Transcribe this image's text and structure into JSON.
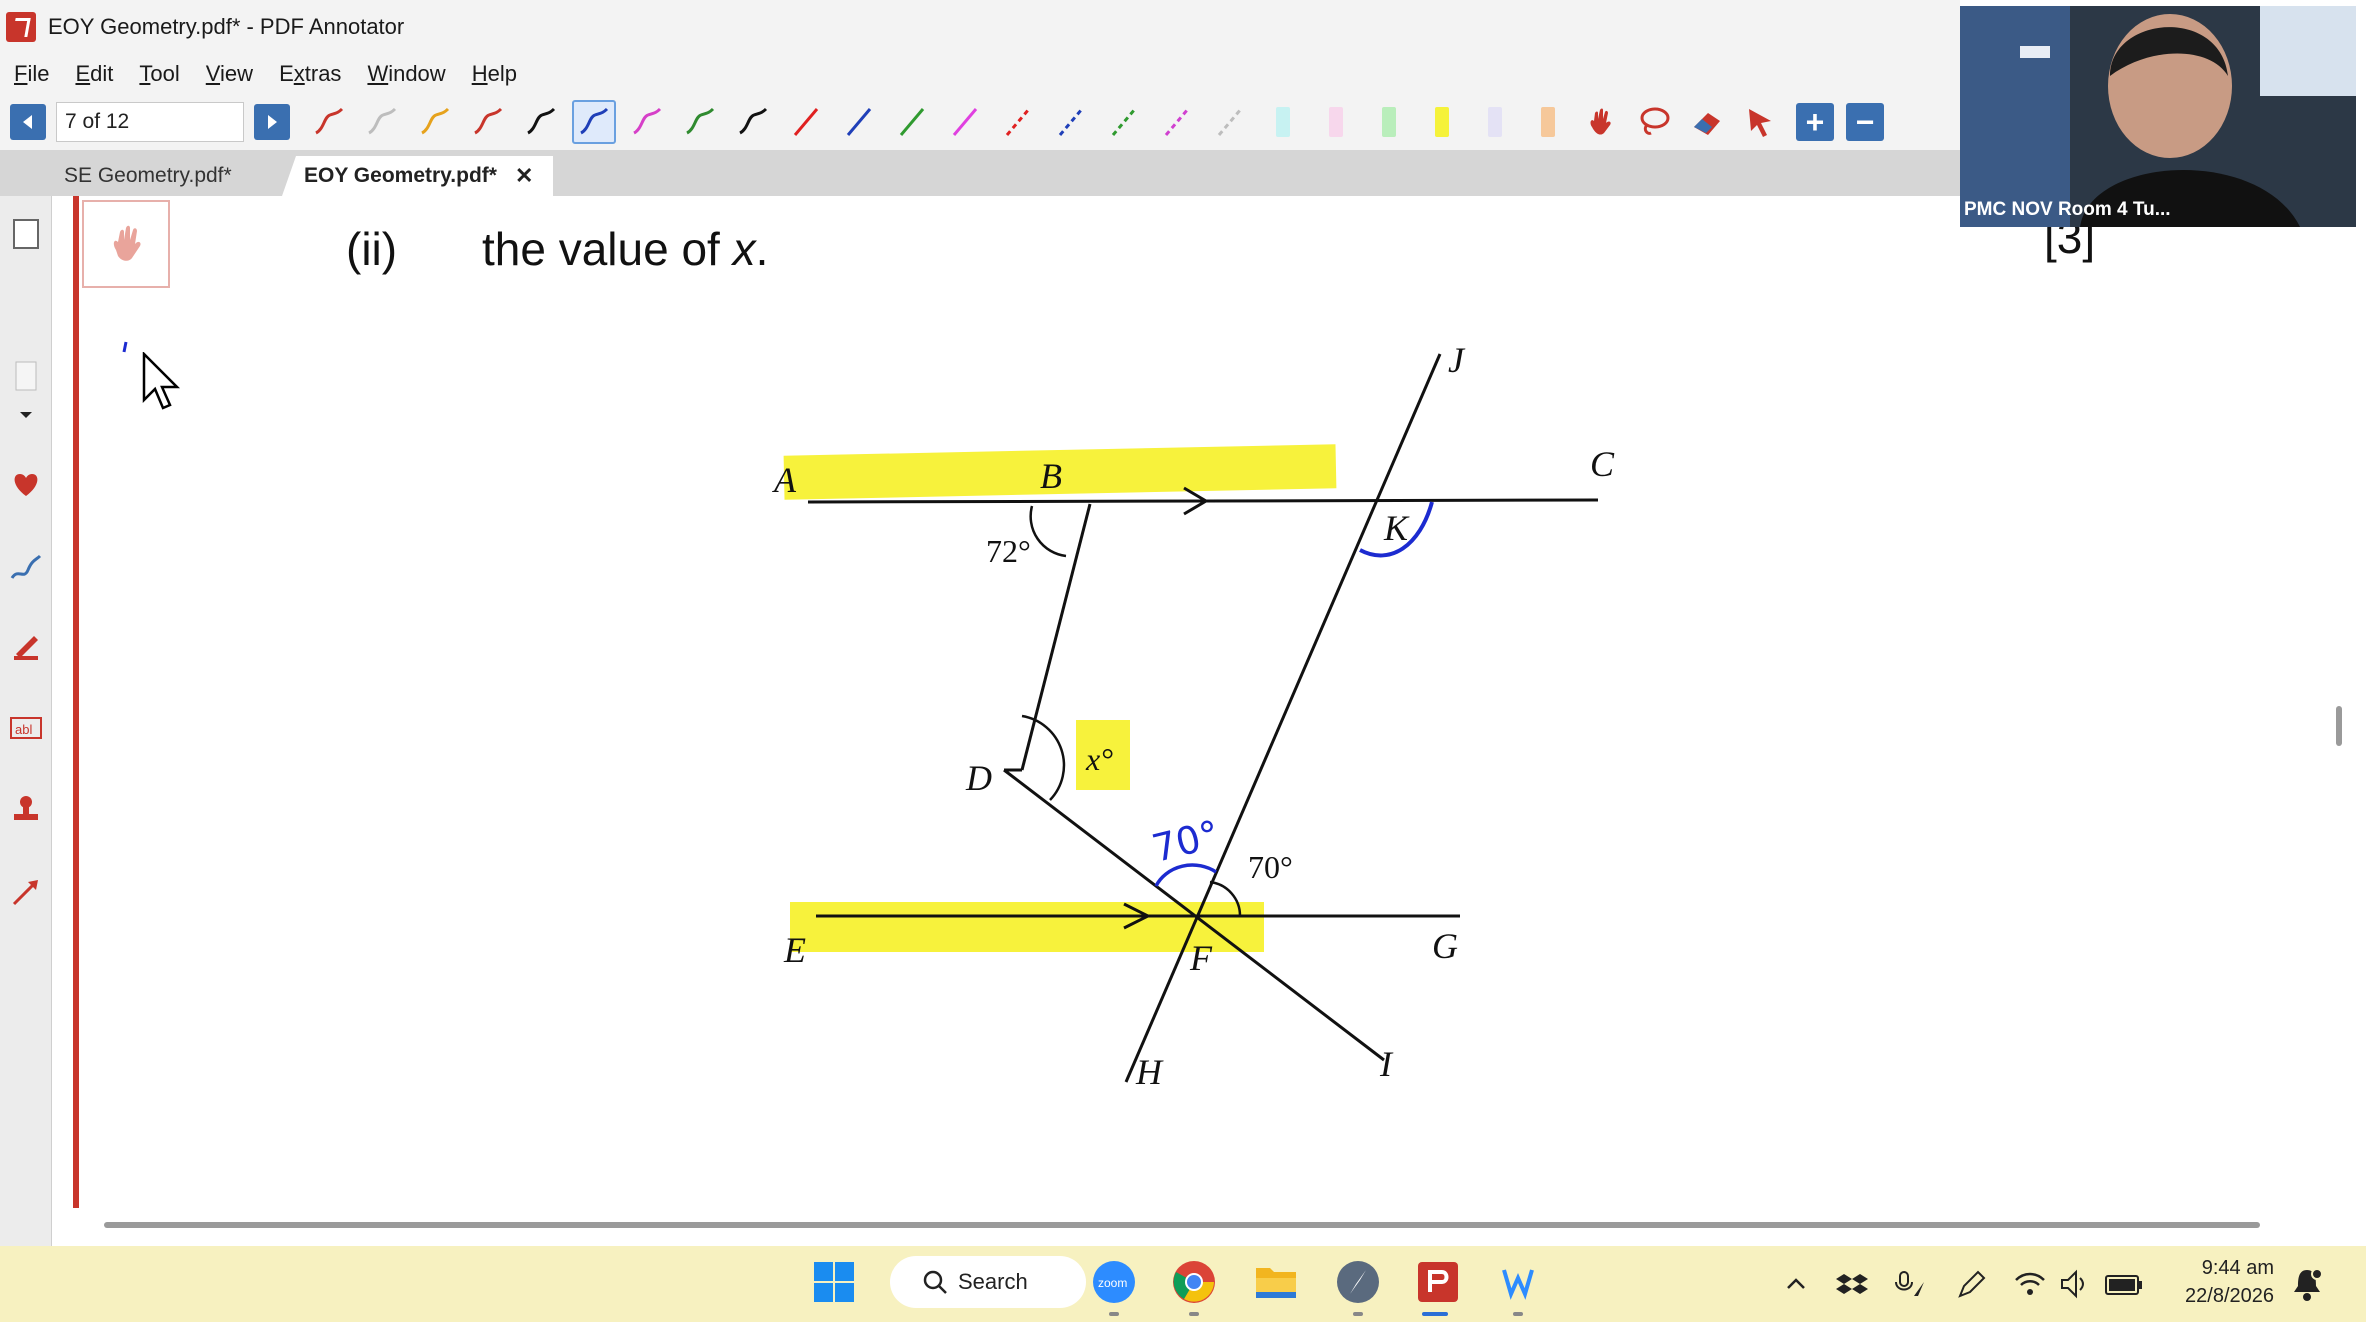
{
  "window": {
    "title": "EOY Geometry.pdf* - PDF Annotator"
  },
  "menu": [
    {
      "label": "File",
      "key": "F"
    },
    {
      "label": "Edit",
      "key": "E"
    },
    {
      "label": "Tool",
      "key": "T"
    },
    {
      "label": "View",
      "key": "V"
    },
    {
      "label": "Extras",
      "key": "x"
    },
    {
      "label": "Window",
      "key": "W"
    },
    {
      "label": "Help",
      "key": "H"
    }
  ],
  "toolbar": {
    "page_indicator": "7 of 12",
    "pen_colors": [
      "#c8352b",
      "#bdbdbd",
      "#e6a21c",
      "#c8352b",
      "#111111",
      "#1f3fb8",
      "#d63fc8",
      "#2f8a2f",
      "#111111"
    ],
    "line_colors": [
      "#e02020",
      "#1f3fb8",
      "#2f9a2f",
      "#e040e0"
    ],
    "dashed_colors": [
      "#e02020",
      "#1f3fb8",
      "#2f9a2f",
      "#d040d0",
      "#bdbdbd"
    ],
    "highlighter_colors": [
      "#c7f2f2",
      "#f7d7ec",
      "#b9eebb",
      "#f5f23a",
      "#e4e2f5",
      "#f6c89a"
    ],
    "tool_icons": [
      "hand-icon",
      "lasso-icon",
      "eraser-icon",
      "pointer-icon"
    ],
    "zoom_in": "+",
    "zoom_out": "−"
  },
  "tabs": [
    {
      "label": "SE Geometry.pdf*",
      "active": false
    },
    {
      "label": "EOY Geometry.pdf*",
      "active": true,
      "close": "✕"
    }
  ],
  "document": {
    "question_number": "(ii)",
    "question_text_prefix": "the value of ",
    "question_variable": "x",
    "question_text_suffix": ".",
    "marks": "[3]",
    "diagram": {
      "points": [
        "A",
        "B",
        "C",
        "D",
        "E",
        "F",
        "G",
        "H",
        "I",
        "J",
        "K"
      ],
      "angle_72": "72°",
      "angle_70": "70°",
      "angle_x": "x°",
      "handwritten_70": "70°",
      "highlight_color": "#f7f23c",
      "ink_color": "#1c2bd0"
    }
  },
  "video": {
    "participant_label": "PMC NOV Room 4 Tu..."
  },
  "taskbar": {
    "search_label": "Search",
    "apps": [
      "windows-start",
      "zoom",
      "chrome",
      "file-explorer",
      "safari-like",
      "pdf-annotator",
      "word-w"
    ],
    "clock_time": "9:44 am",
    "clock_date": "22/8/2026"
  }
}
